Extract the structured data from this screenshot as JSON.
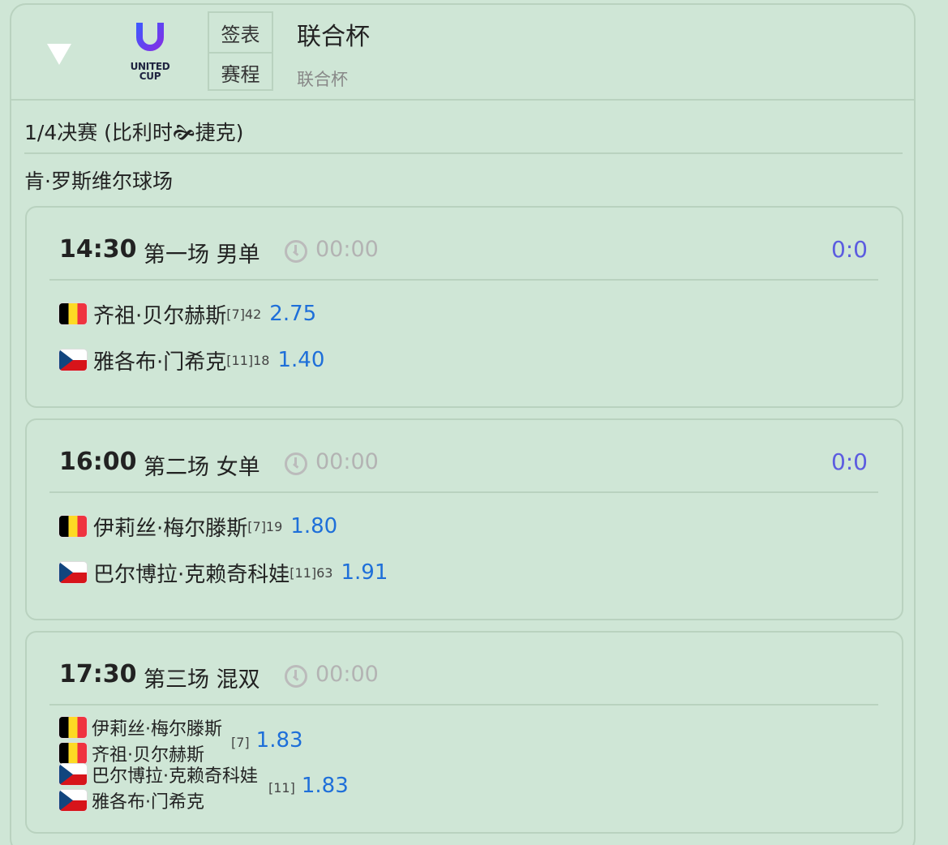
{
  "header": {
    "logo_text": "UNITED\nCUP",
    "tabs": [
      "签表",
      "赛程"
    ],
    "title": "联合杯",
    "subtitle": "联合杯"
  },
  "round": "1/4决赛 (比利时🙞捷克)",
  "venue": "肯·罗斯维尔球场",
  "matches": [
    {
      "time": "14:30",
      "label": "第一场 男单",
      "clock": "00:00",
      "score": "0:0",
      "players": [
        {
          "flag": "belgium-flag",
          "name": "齐祖·贝尔赫斯",
          "seed": "[7]42",
          "odds": "2.75"
        },
        {
          "flag": "czech-flag",
          "name": "雅各布·门希克",
          "seed": "[11]18",
          "odds": "1.40"
        }
      ]
    },
    {
      "time": "16:00",
      "label": "第二场 女单",
      "clock": "00:00",
      "score": "0:0",
      "players": [
        {
          "flag": "belgium-flag",
          "name": "伊莉丝·梅尔滕斯",
          "seed": "[7]19",
          "odds": "1.80"
        },
        {
          "flag": "czech-flag",
          "name": "巴尔博拉·克赖奇科娃",
          "seed": "[11]63",
          "odds": "1.91"
        }
      ]
    },
    {
      "time": "17:30",
      "label": "第三场 混双",
      "clock": "00:00",
      "teams": [
        {
          "players": [
            "伊莉丝·梅尔滕斯",
            "齐祖·贝尔赫斯"
          ],
          "flag": "belgium-flag",
          "seed": "[7]",
          "odds": "1.83"
        },
        {
          "players": [
            "巴尔博拉·克赖奇科娃",
            "雅各布·门希克"
          ],
          "flag": "czech-flag",
          "seed": "[11]",
          "odds": "1.83"
        }
      ]
    }
  ],
  "colors": {
    "accent_odds": "#1e6fd9",
    "score": "#5c5ce0",
    "background": "#cfe6d6",
    "border": "#b9d2bf"
  }
}
